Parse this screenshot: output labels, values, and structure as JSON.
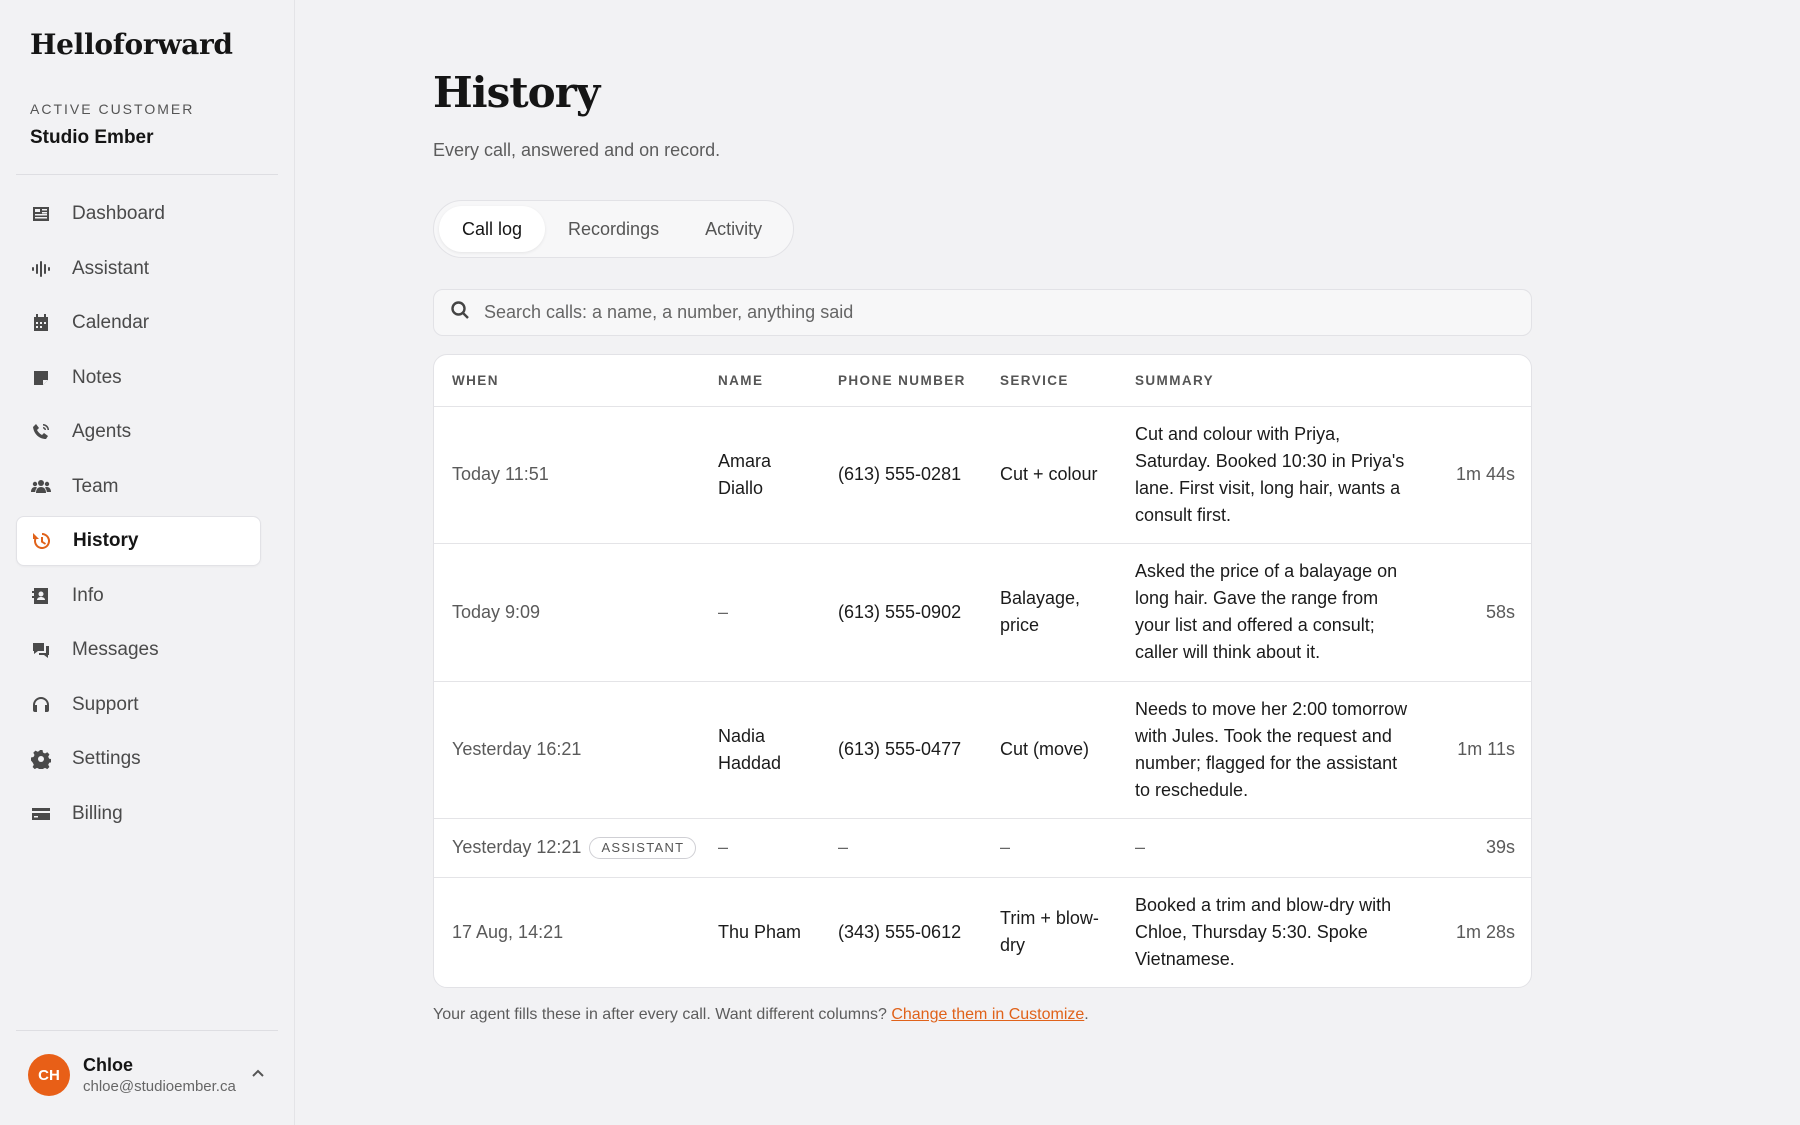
{
  "app": {
    "brand": "Helloforward"
  },
  "customer": {
    "label": "ACTIVE CUSTOMER",
    "name": "Studio Ember"
  },
  "nav": [
    {
      "label": "Dashboard",
      "icon": "dashboard-icon"
    },
    {
      "label": "Assistant",
      "icon": "waveform-icon"
    },
    {
      "label": "Calendar",
      "icon": "calendar-icon"
    },
    {
      "label": "Notes",
      "icon": "note-icon"
    },
    {
      "label": "Agents",
      "icon": "phone-icon"
    },
    {
      "label": "Team",
      "icon": "team-icon"
    },
    {
      "label": "History",
      "icon": "history-icon",
      "active": true
    },
    {
      "label": "Info",
      "icon": "contact-card-icon"
    },
    {
      "label": "Messages",
      "icon": "chat-icon"
    },
    {
      "label": "Support",
      "icon": "headset-icon"
    },
    {
      "label": "Settings",
      "icon": "gear-icon"
    },
    {
      "label": "Billing",
      "icon": "credit-card-icon"
    }
  ],
  "user": {
    "initials": "CH",
    "name": "Chloe",
    "email": "chloe@studioember.ca"
  },
  "page": {
    "title": "History",
    "subtitle": "Every call, answered and on record."
  },
  "tabs": [
    {
      "label": "Call log",
      "active": true
    },
    {
      "label": "Recordings"
    },
    {
      "label": "Activity"
    }
  ],
  "search": {
    "placeholder": "Search calls: a name, a number, anything said",
    "value": ""
  },
  "table": {
    "columns": [
      "WHEN",
      "NAME",
      "PHONE NUMBER",
      "SERVICE",
      "SUMMARY",
      ""
    ],
    "rows": [
      {
        "when": "Today 11:51",
        "badge": "",
        "name": "Amara Diallo",
        "phone": "(613) 555-0281",
        "service": "Cut + colour",
        "summary": "Cut and colour with Priya, Saturday. Booked 10:30 in Priya's lane. First visit, long hair, wants a consult first.",
        "duration": "1m 44s"
      },
      {
        "when": "Today 9:09",
        "badge": "",
        "name": "–",
        "phone": "(613) 555-0902",
        "service": "Balayage, price",
        "summary": "Asked the price of a balayage on long hair. Gave the range from your list and offered a consult; caller will think about it.",
        "duration": "58s"
      },
      {
        "when": "Yesterday 16:21",
        "badge": "",
        "name": "Nadia Haddad",
        "phone": "(613) 555-0477",
        "service": "Cut (move)",
        "summary": "Needs to move her 2:00 tomorrow with Jules. Took the request and number; flagged for the assistant to reschedule.",
        "duration": "1m 11s"
      },
      {
        "when": "Yesterday 12:21",
        "badge": "ASSISTANT",
        "name": "–",
        "phone": "–",
        "service": "–",
        "summary": "–",
        "duration": "39s"
      },
      {
        "when": "17 Aug, 14:21",
        "badge": "",
        "name": "Thu Pham",
        "phone": "(343) 555-0612",
        "service": "Trim + blow-dry",
        "summary": "Booked a trim and blow-dry with Chloe, Thursday 5:30. Spoke Vietnamese.",
        "duration": "1m 28s"
      }
    ]
  },
  "footnote": {
    "text": "Your agent fills these in after every call. Want different columns? ",
    "link": "Change them in Customize",
    "end": "."
  },
  "colors": {
    "accent": "#e0621a",
    "avatar": "#e85f17",
    "background": "#f2f2f4"
  }
}
